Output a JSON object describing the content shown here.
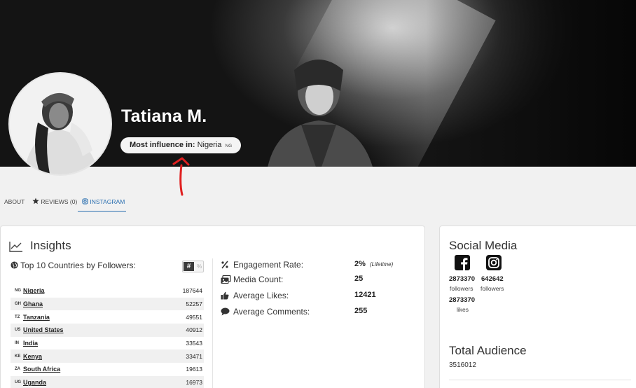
{
  "profile": {
    "name": "Tatiana M.",
    "influence_label": "Most influence in:",
    "influence_country": "Nigeria",
    "influence_code": "NG"
  },
  "tabs": [
    {
      "label": "ABOUT",
      "active": false
    },
    {
      "label": "REVIEWS (0)",
      "icon": "star-icon",
      "active": false
    },
    {
      "label": "INSTAGRAM",
      "icon": "instagram-icon",
      "active": true
    }
  ],
  "insights": {
    "title": "Insights",
    "countries_title": "Top 10 Countries by Followers:",
    "toggle_count": "#",
    "toggle_percent": "%",
    "countries": [
      {
        "code": "NG",
        "name": "Nigeria",
        "value": "187644"
      },
      {
        "code": "GH",
        "name": "Ghana",
        "value": "52257"
      },
      {
        "code": "TZ",
        "name": "Tanzania",
        "value": "49551"
      },
      {
        "code": "US",
        "name": "United States",
        "value": "40912"
      },
      {
        "code": "IN",
        "name": "India",
        "value": "33543"
      },
      {
        "code": "KE",
        "name": "Kenya",
        "value": "33471"
      },
      {
        "code": "ZA",
        "name": "South Africa",
        "value": "19613"
      },
      {
        "code": "UG",
        "name": "Uganda",
        "value": "16973"
      }
    ],
    "stats": [
      {
        "icon": "percent-icon",
        "label": "Engagement Rate:",
        "value": "2%",
        "note": "(Lifetime)"
      },
      {
        "icon": "media-icon",
        "label": "Media Count:",
        "value": "25",
        "note": ""
      },
      {
        "icon": "thumbs-up-icon",
        "label": "Average Likes:",
        "value": "12421",
        "note": ""
      },
      {
        "icon": "comment-icon",
        "label": "Average Comments:",
        "value": "255",
        "note": ""
      }
    ]
  },
  "social": {
    "title": "Social Media",
    "facebook": {
      "followers": "2873370",
      "followers_label": "followers",
      "likes": "2873370",
      "likes_label": "likes"
    },
    "instagram": {
      "followers": "642642",
      "followers_label": "followers"
    },
    "audience_title": "Total Audience",
    "audience_value": "3516012"
  },
  "colors": {
    "accent": "#2a6fb0",
    "annotation": "#e02020",
    "hero_dark": "#141414"
  }
}
